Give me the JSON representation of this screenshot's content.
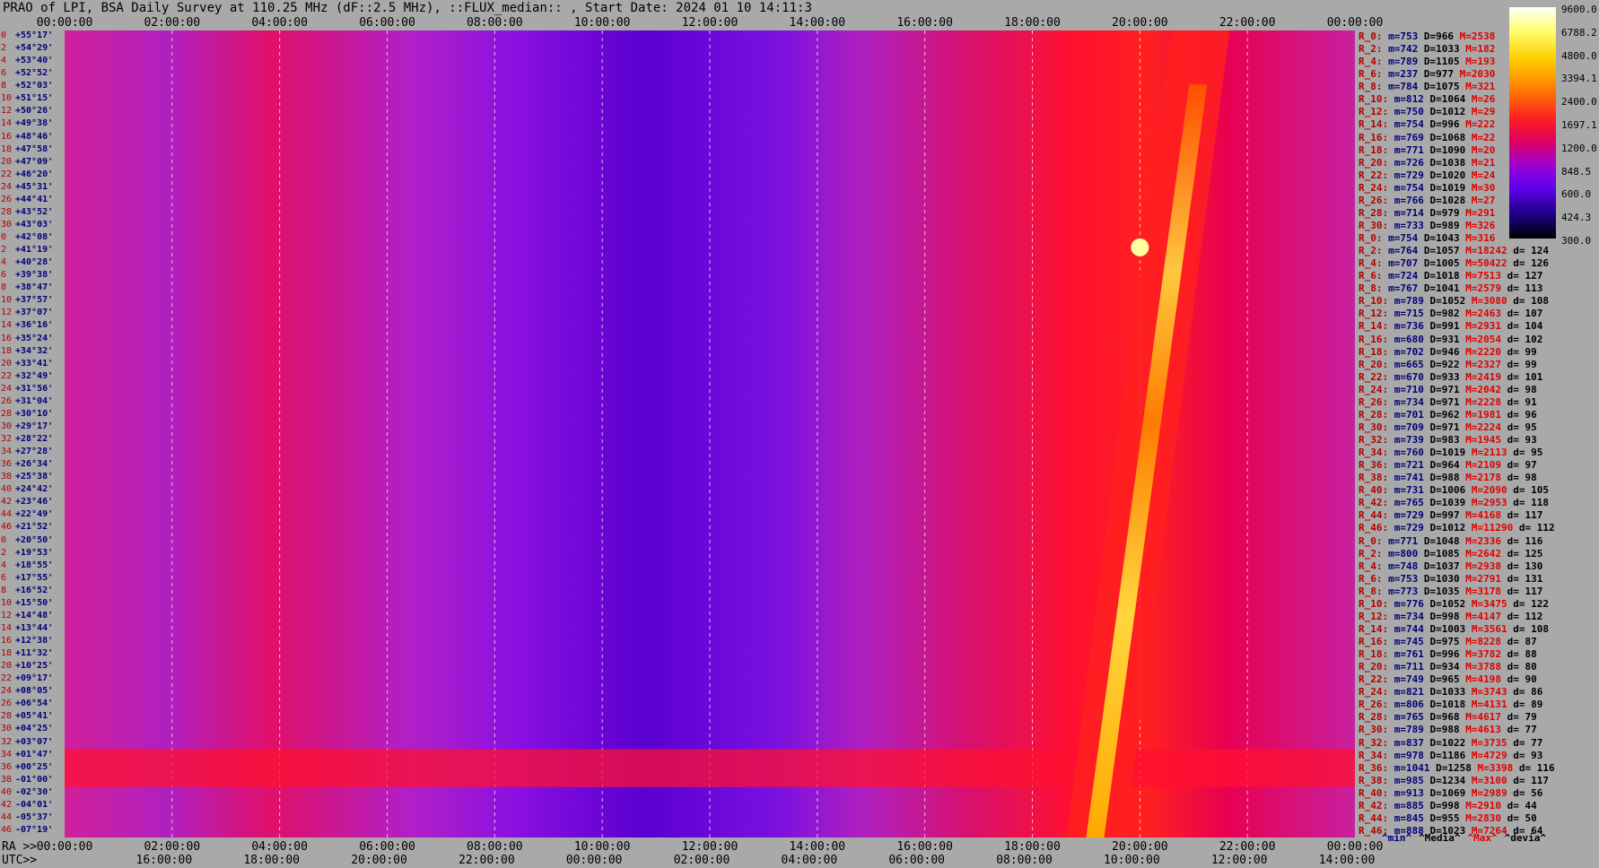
{
  "title": "PRAO of LPI, BSA Daily Survey at 110.25 MHz (dF::2.5 MHz), ::FLUX_median:: , Start Date: 2024 01 10 14:11:3",
  "top_axis_ticks": [
    "00:00:00",
    "02:00:00",
    "04:00:00",
    "06:00:00",
    "08:00:00",
    "10:00:00",
    "12:00:00",
    "14:00:00",
    "16:00:00",
    "18:00:00",
    "20:00:00",
    "22:00:00",
    "00:00:00"
  ],
  "bottom_axis_ra_label": "RA >>",
  "bottom_axis_ra_ticks": [
    "00:00:00",
    "02:00:00",
    "04:00:00",
    "06:00:00",
    "08:00:00",
    "10:00:00",
    "12:00:00",
    "14:00:00",
    "16:00:00",
    "18:00:00",
    "20:00:00",
    "22:00:00",
    "00:00:00"
  ],
  "bottom_axis_utc_label": "UTC>>",
  "bottom_axis_utc_ticks": [
    "16:00:00",
    "18:00:00",
    "20:00:00",
    "22:00:00",
    "00:00:00",
    "02:00:00",
    "04:00:00",
    "06:00:00",
    "08:00:00",
    "10:00:00",
    "12:00:00",
    "14:00:00"
  ],
  "colorbar_ticks": [
    "9600.0",
    "6788.2",
    "4800.0",
    "3394.1",
    "2400.0",
    "1697.1",
    "1200.0",
    "848.5",
    "600.0",
    "424.3",
    "300.0"
  ],
  "footer_legend": [
    "^min^",
    "^Media^",
    "^Max^",
    "^devia^"
  ],
  "declinations": [
    "+55°17'",
    "+54°29'",
    "+53°40'",
    "+52°52'",
    "+52°03'",
    "+51°15'",
    "+50°26'",
    "+49°38'",
    "+48°46'",
    "+47°58'",
    "+47°09'",
    "+46°20'",
    "+45°31'",
    "+44°41'",
    "+43°52'",
    "+43°03'",
    "+42°08'",
    "+41°19'",
    "+40°28'",
    "+39°38'",
    "+38°47'",
    "+37°57'",
    "+37°07'",
    "+36°16'",
    "+35°24'",
    "+34°32'",
    "+33°41'",
    "+32°49'",
    "+31°56'",
    "+31°04'",
    "+30°10'",
    "+29°17'",
    "+28°22'",
    "+27°28'",
    "+26°34'",
    "+25°38'",
    "+24°42'",
    "+23°46'",
    "+22°49'",
    "+21°52'",
    "+20°50'",
    "+19°53'",
    "+18°55'",
    "+17°55'",
    "+16°52'",
    "+15°50'",
    "+14°48'",
    "+13°44'",
    "+12°38'",
    "+11°32'",
    "+10°25'",
    "+09°17'",
    "+08°05'",
    "+06°54'",
    "+05°41'",
    "+04°25'",
    "+03°07'",
    "+01°47'",
    "+00°25'",
    "-01°00'",
    "-02°30'",
    "-04°01'",
    "-05°37'",
    "-07°19'"
  ],
  "beam_indices": [
    "0",
    "2",
    "4",
    "6",
    "8",
    "10",
    "12",
    "14",
    "16",
    "18",
    "20",
    "22",
    "24",
    "26",
    "28",
    "30",
    "0",
    "2",
    "4",
    "6",
    "8",
    "10",
    "12",
    "14",
    "16",
    "18",
    "20",
    "22",
    "24",
    "26",
    "28",
    "30",
    "32",
    "34",
    "36",
    "38",
    "40",
    "42",
    "44",
    "46",
    "0",
    "2",
    "4",
    "6",
    "8",
    "10",
    "12",
    "14",
    "16",
    "18",
    "20",
    "22",
    "24",
    "26",
    "28",
    "30",
    "32",
    "34",
    "36",
    "38",
    "40",
    "42",
    "44",
    "46"
  ],
  "stats": [
    {
      "r": "R_0:",
      "m": "m=753",
      "d": "D=966",
      "mx": "M=2538",
      "dv": ""
    },
    {
      "r": "R_2:",
      "m": "m=742",
      "d": "D=1033",
      "mx": "M=182",
      "dv": ""
    },
    {
      "r": "R_4:",
      "m": "m=789",
      "d": "D=1105",
      "mx": "M=193",
      "dv": ""
    },
    {
      "r": "R_6:",
      "m": "m=237",
      "d": "D=977",
      "mx": "M=2030",
      "dv": ""
    },
    {
      "r": "R_8:",
      "m": "m=784",
      "d": "D=1075",
      "mx": "M=321",
      "dv": ""
    },
    {
      "r": "R_10:",
      "m": "m=812",
      "d": "D=1064",
      "mx": "M=26",
      "dv": ""
    },
    {
      "r": "R_12:",
      "m": "m=750",
      "d": "D=1012",
      "mx": "M=29",
      "dv": ""
    },
    {
      "r": "R_14:",
      "m": "m=754",
      "d": "D=996",
      "mx": "M=222",
      "dv": ""
    },
    {
      "r": "R_16:",
      "m": "m=769",
      "d": "D=1068",
      "mx": "M=22",
      "dv": ""
    },
    {
      "r": "R_18:",
      "m": "m=771",
      "d": "D=1090",
      "mx": "M=20",
      "dv": ""
    },
    {
      "r": "R_20:",
      "m": "m=726",
      "d": "D=1038",
      "mx": "M=21",
      "dv": ""
    },
    {
      "r": "R_22:",
      "m": "m=729",
      "d": "D=1020",
      "mx": "M=24",
      "dv": ""
    },
    {
      "r": "R_24:",
      "m": "m=754",
      "d": "D=1019",
      "mx": "M=30",
      "dv": ""
    },
    {
      "r": "R_26:",
      "m": "m=766",
      "d": "D=1028",
      "mx": "M=27",
      "dv": ""
    },
    {
      "r": "R_28:",
      "m": "m=714",
      "d": "D=979",
      "mx": "M=291",
      "dv": ""
    },
    {
      "r": "R_30:",
      "m": "m=733",
      "d": "D=989",
      "mx": "M=326",
      "dv": ""
    },
    {
      "r": "R_0:",
      "m": "m=754",
      "d": "D=1043",
      "mx": "M=316",
      "dv": ""
    },
    {
      "r": "R_2:",
      "m": "m=764",
      "d": "D=1057",
      "mx": "M=18242",
      "dv": "d= 124"
    },
    {
      "r": "R_4:",
      "m": "m=707",
      "d": "D=1005",
      "mx": "M=50422",
      "dv": "d= 126"
    },
    {
      "r": "R_6:",
      "m": "m=724",
      "d": "D=1018",
      "mx": "M=7513",
      "dv": "d= 127"
    },
    {
      "r": "R_8:",
      "m": "m=767",
      "d": "D=1041",
      "mx": "M=2579",
      "dv": "d= 113"
    },
    {
      "r": "R_10:",
      "m": "m=789",
      "d": "D=1052",
      "mx": "M=3080",
      "dv": "d= 108"
    },
    {
      "r": "R_12:",
      "m": "m=715",
      "d": "D=982",
      "mx": "M=2463",
      "dv": "d= 107"
    },
    {
      "r": "R_14:",
      "m": "m=736",
      "d": "D=991",
      "mx": "M=2931",
      "dv": "d= 104"
    },
    {
      "r": "R_16:",
      "m": "m=680",
      "d": "D=931",
      "mx": "M=2054",
      "dv": "d= 102"
    },
    {
      "r": "R_18:",
      "m": "m=702",
      "d": "D=946",
      "mx": "M=2220",
      "dv": "d= 99"
    },
    {
      "r": "R_20:",
      "m": "m=665",
      "d": "D=922",
      "mx": "M=2327",
      "dv": "d= 99"
    },
    {
      "r": "R_22:",
      "m": "m=670",
      "d": "D=933",
      "mx": "M=2419",
      "dv": "d= 101"
    },
    {
      "r": "R_24:",
      "m": "m=710",
      "d": "D=971",
      "mx": "M=2042",
      "dv": "d= 98"
    },
    {
      "r": "R_26:",
      "m": "m=734",
      "d": "D=971",
      "mx": "M=2228",
      "dv": "d= 91"
    },
    {
      "r": "R_28:",
      "m": "m=701",
      "d": "D=962",
      "mx": "M=1981",
      "dv": "d= 96"
    },
    {
      "r": "R_30:",
      "m": "m=709",
      "d": "D=971",
      "mx": "M=2224",
      "dv": "d= 95"
    },
    {
      "r": "R_32:",
      "m": "m=739",
      "d": "D=983",
      "mx": "M=1945",
      "dv": "d= 93"
    },
    {
      "r": "R_34:",
      "m": "m=760",
      "d": "D=1019",
      "mx": "M=2113",
      "dv": "d= 95"
    },
    {
      "r": "R_36:",
      "m": "m=721",
      "d": "D=964",
      "mx": "M=2109",
      "dv": "d= 97"
    },
    {
      "r": "R_38:",
      "m": "m=741",
      "d": "D=988",
      "mx": "M=2178",
      "dv": "d= 98"
    },
    {
      "r": "R_40:",
      "m": "m=731",
      "d": "D=1006",
      "mx": "M=2090",
      "dv": "d= 105"
    },
    {
      "r": "R_42:",
      "m": "m=765",
      "d": "D=1039",
      "mx": "M=2953",
      "dv": "d= 118"
    },
    {
      "r": "R_44:",
      "m": "m=729",
      "d": "D=997",
      "mx": "M=4168",
      "dv": "d= 117"
    },
    {
      "r": "R_46:",
      "m": "m=729",
      "d": "D=1012",
      "mx": "M=11290",
      "dv": "d= 112"
    },
    {
      "r": "R_0:",
      "m": "m=771",
      "d": "D=1048",
      "mx": "M=2336",
      "dv": "d= 116"
    },
    {
      "r": "R_2:",
      "m": "m=800",
      "d": "D=1085",
      "mx": "M=2642",
      "dv": "d= 125"
    },
    {
      "r": "R_4:",
      "m": "m=748",
      "d": "D=1037",
      "mx": "M=2938",
      "dv": "d= 130"
    },
    {
      "r": "R_6:",
      "m": "m=753",
      "d": "D=1030",
      "mx": "M=2791",
      "dv": "d= 131"
    },
    {
      "r": "R_8:",
      "m": "m=773",
      "d": "D=1035",
      "mx": "M=3178",
      "dv": "d= 117"
    },
    {
      "r": "R_10:",
      "m": "m=776",
      "d": "D=1052",
      "mx": "M=3475",
      "dv": "d= 122"
    },
    {
      "r": "R_12:",
      "m": "m=734",
      "d": "D=998",
      "mx": "M=4147",
      "dv": "d= 112"
    },
    {
      "r": "R_14:",
      "m": "m=744",
      "d": "D=1003",
      "mx": "M=3561",
      "dv": "d= 108"
    },
    {
      "r": "R_16:",
      "m": "m=745",
      "d": "D=975",
      "mx": "M=8228",
      "dv": "d= 87"
    },
    {
      "r": "R_18:",
      "m": "m=761",
      "d": "D=996",
      "mx": "M=3782",
      "dv": "d= 88"
    },
    {
      "r": "R_20:",
      "m": "m=711",
      "d": "D=934",
      "mx": "M=3788",
      "dv": "d= 80"
    },
    {
      "r": "R_22:",
      "m": "m=749",
      "d": "D=965",
      "mx": "M=4198",
      "dv": "d= 90"
    },
    {
      "r": "R_24:",
      "m": "m=821",
      "d": "D=1033",
      "mx": "M=3743",
      "dv": "d= 86"
    },
    {
      "r": "R_26:",
      "m": "m=806",
      "d": "D=1018",
      "mx": "M=4131",
      "dv": "d= 89"
    },
    {
      "r": "R_28:",
      "m": "m=765",
      "d": "D=968",
      "mx": "M=4617",
      "dv": "d= 79"
    },
    {
      "r": "R_30:",
      "m": "m=789",
      "d": "D=988",
      "mx": "M=4613",
      "dv": "d= 77"
    },
    {
      "r": "R_32:",
      "m": "m=837",
      "d": "D=1022",
      "mx": "M=3735",
      "dv": "d= 77"
    },
    {
      "r": "R_34:",
      "m": "m=978",
      "d": "D=1186",
      "mx": "M=4729",
      "dv": "d= 93"
    },
    {
      "r": "R_36:",
      "m": "m=1041",
      "d": "D=1258",
      "mx": "M=3398",
      "dv": "d= 116"
    },
    {
      "r": "R_38:",
      "m": "m=985",
      "d": "D=1234",
      "mx": "M=3100",
      "dv": "d= 117"
    },
    {
      "r": "R_40:",
      "m": "m=913",
      "d": "D=1069",
      "mx": "M=2989",
      "dv": "d= 56"
    },
    {
      "r": "R_42:",
      "m": "m=885",
      "d": "D=998",
      "mx": "M=2910",
      "dv": "d= 44"
    },
    {
      "r": "R_44:",
      "m": "m=845",
      "d": "D=955",
      "mx": "M=2830",
      "dv": "d= 50"
    },
    {
      "r": "R_46:",
      "m": "m=888",
      "d": "D=1023",
      "mx": "M=7264",
      "dv": "d= 64"
    }
  ],
  "chart_data": {
    "type": "heatmap",
    "title": "PRAO of LPI, BSA Daily Survey at 110.25 MHz (dF::2.5 MHz), ::FLUX_median:: , Start Date: 2024 01 10 14:11:3",
    "x_axis": "RA / UTC",
    "x_range_hours": [
      0,
      24
    ],
    "y_axis": "Declination (beam)",
    "rows": 64,
    "color_scale": "log",
    "color_range": [
      300.0,
      9600.0
    ],
    "colors": {
      "low": "#000000",
      "mid_low": "#6000f0",
      "mid": "#e00060",
      "mid_high": "#ff2020",
      "high": "#ffd000",
      "max": "#ffffff"
    },
    "features": [
      {
        "name": "galactic plane ridge",
        "ra_start_hours": 18.8,
        "ra_end_hours": 21.0,
        "dec_start": "-07°19'",
        "dec_end": "+55°17'"
      },
      {
        "name": "bright point source",
        "ra_hours": 20.0,
        "dec": "+40°28'"
      }
    ]
  }
}
